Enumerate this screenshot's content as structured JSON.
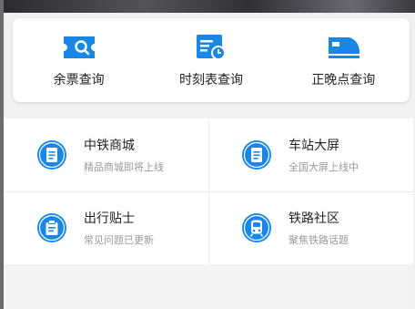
{
  "quick_actions": [
    {
      "label": "余票查询",
      "icon": "ticket-search-icon"
    },
    {
      "label": "时刻表查询",
      "icon": "timetable-clock-icon"
    },
    {
      "label": "正晚点查询",
      "icon": "train-icon"
    }
  ],
  "services": [
    {
      "title": "中铁商城",
      "subtitle": "精品商城即将上线",
      "icon": "document-icon"
    },
    {
      "title": "车站大屏",
      "subtitle": "全国大屏上线中",
      "icon": "document-icon"
    },
    {
      "title": "出行贴士",
      "subtitle": "常见问题已更新",
      "icon": "clipboard-icon"
    },
    {
      "title": "铁路社区",
      "subtitle": "聚焦铁路话题",
      "icon": "train-front-icon"
    }
  ],
  "colors": {
    "accent": "#1a86e6",
    "card_bg": "#ffffff",
    "page_bg": "#f1f1f1"
  }
}
